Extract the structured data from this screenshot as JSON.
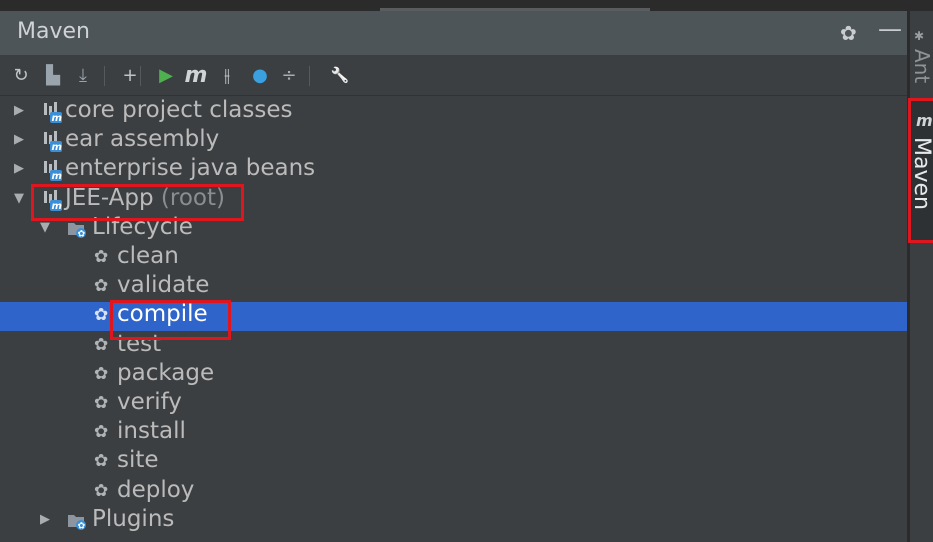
{
  "panel": {
    "title": "Maven"
  },
  "header_icons": {
    "settings": "gear-icon",
    "hide": "minimize-icon"
  },
  "toolbar": [
    {
      "name": "reimport-icon",
      "glyph": "↻",
      "color": "#c0c4c7"
    },
    {
      "name": "generate-sources-icon",
      "glyph": "▙",
      "color": "#9aa4ad"
    },
    {
      "name": "download-icon",
      "glyph": "⤓",
      "color": "#9aa4ad"
    },
    {
      "name": "add-icon",
      "glyph": "+",
      "color": "#c0c4c7"
    },
    {
      "name": "run-icon",
      "glyph": "▶",
      "color": "#4fb04f"
    },
    {
      "name": "execute-goal-icon",
      "glyph": "m",
      "color": "#d0d4d7"
    },
    {
      "name": "toggle-offline-icon",
      "glyph": "⫲",
      "color": "#c0c4c7"
    },
    {
      "name": "skip-tests-icon",
      "glyph": "●",
      "color": "#3aa0e0"
    },
    {
      "name": "collapse-all-icon",
      "glyph": "÷",
      "color": "#a9adb0"
    },
    {
      "name": "settings-wrench-icon",
      "glyph": "🔧",
      "color": "#c0c4c7"
    }
  ],
  "tree": [
    {
      "label": "core project classes",
      "type": "module",
      "arrow": "▶"
    },
    {
      "label": "ear assembly",
      "type": "module",
      "arrow": "▶"
    },
    {
      "label": "enterprise java beans",
      "type": "module",
      "arrow": "▶"
    },
    {
      "label": "JEE-App",
      "suffix": "(root)",
      "type": "module",
      "arrow": "▼"
    },
    {
      "label": "Lifecycle",
      "type": "folder",
      "arrow": "▼"
    },
    {
      "label": "clean",
      "type": "goal"
    },
    {
      "label": "validate",
      "type": "goal"
    },
    {
      "label": "compile",
      "type": "goal",
      "selected": true
    },
    {
      "label": "test",
      "type": "goal"
    },
    {
      "label": "package",
      "type": "goal"
    },
    {
      "label": "verify",
      "type": "goal"
    },
    {
      "label": "install",
      "type": "goal"
    },
    {
      "label": "site",
      "type": "goal"
    },
    {
      "label": "deploy",
      "type": "goal"
    },
    {
      "label": "Plugins",
      "type": "folder",
      "arrow": "▶"
    }
  ],
  "side_tabs": [
    {
      "label": "Ant",
      "icon": "ant-icon"
    },
    {
      "label": "Maven",
      "icon": "maven-m-icon",
      "prefix": "m"
    }
  ],
  "colors": {
    "selection": "#2f65ca",
    "highlight_box": "#e0161f",
    "header_bg": "#4e5559"
  }
}
